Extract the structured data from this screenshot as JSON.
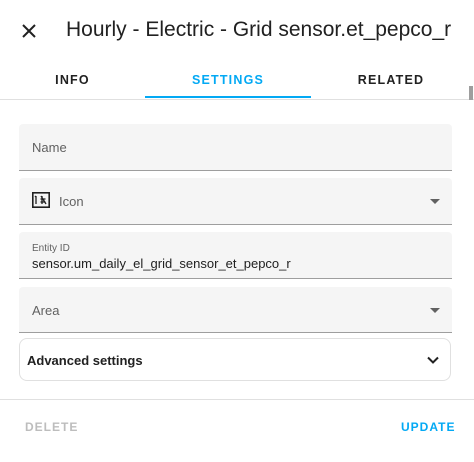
{
  "dialog": {
    "title": "Hourly - Electric - Grid sensor.et_pepco_r",
    "close_icon": "close-icon"
  },
  "tabs": [
    {
      "label": "INFO",
      "active": false
    },
    {
      "label": "SETTINGS",
      "active": true
    },
    {
      "label": "RELATED",
      "active": false
    }
  ],
  "form": {
    "name": {
      "placeholder": "Name",
      "value": ""
    },
    "icon": {
      "label": "Icon",
      "icon": "ab-testing-icon"
    },
    "entity_id": {
      "label": "Entity ID",
      "value": "sensor.um_daily_el_grid_sensor_et_pepco_r"
    },
    "area": {
      "label": "Area"
    },
    "advanced": {
      "label": "Advanced settings"
    }
  },
  "footer": {
    "delete_label": "DELETE",
    "update_label": "UPDATE"
  },
  "colors": {
    "accent": "#03a9f4",
    "disabled": "#bdbdbd",
    "field_bg": "#f5f5f5"
  }
}
